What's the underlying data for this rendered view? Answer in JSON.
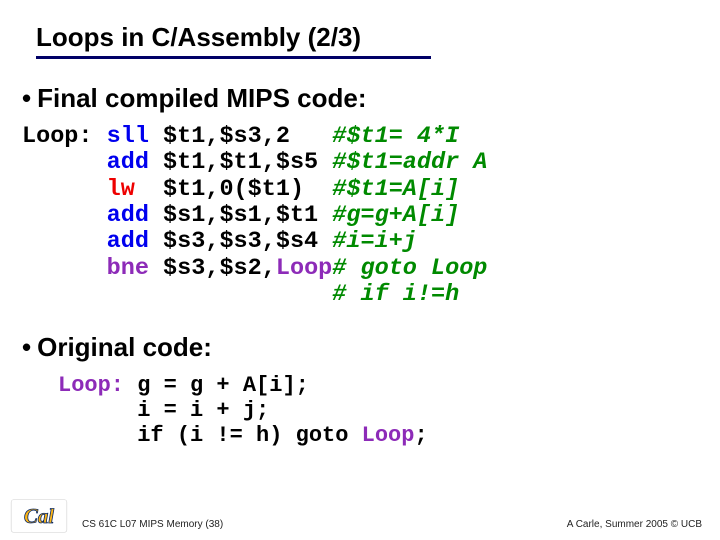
{
  "title": "Loops in C/Assembly (2/3)",
  "bullets": {
    "b1_text": "Final compiled MIPS code:",
    "b2_text": "Original code:"
  },
  "code1": {
    "col1_l0": "Loop:",
    "col1_l1": " ",
    "col1_l2": " ",
    "col1_l3": " ",
    "col1_l4": " ",
    "col1_l5": " ",
    "col1_l6": " ",
    "col2_l0": " sll ",
    "col2_l1": " add ",
    "col2_l2": " lw  ",
    "col2_l3": " add ",
    "col2_l4": " add ",
    "col2_l5": " bne ",
    "col2_l6": " ",
    "col3_l0": "$t1,$s3,2   ",
    "col3_l1": "$t1,$t1,$s5 ",
    "col3_l2": "$t1,0($t1)  ",
    "col3_l3": "$s1,$s1,$t1 ",
    "col3_l4": "$s3,$s3,$s4 ",
    "col3_l5_a": "$s3,$s2,",
    "col3_l5_b": "Loop",
    "col3_l6": " ",
    "col4_l0": "#$t1= 4*I",
    "col4_l1": "#$t1=addr A",
    "col4_l2": "#$t1=A[i]",
    "col4_l3": "#g=g+A[i]",
    "col4_l4": "#i=i+j",
    "col4_l5": "# goto Loop",
    "col4_l6": "# if i!=h"
  },
  "code2": {
    "l0_a": "Loop:",
    "l0_b": " g = g + A[i];",
    "l1": "      i = i + j;",
    "l2_a": "      if (i != h) goto ",
    "l2_b": "Loop",
    "l2_c": ";"
  },
  "footer": {
    "left": "CS 61C L07 MIPS Memory (38)",
    "right": "A Carle, Summer 2005 © UCB"
  },
  "logo_label": "Cal"
}
